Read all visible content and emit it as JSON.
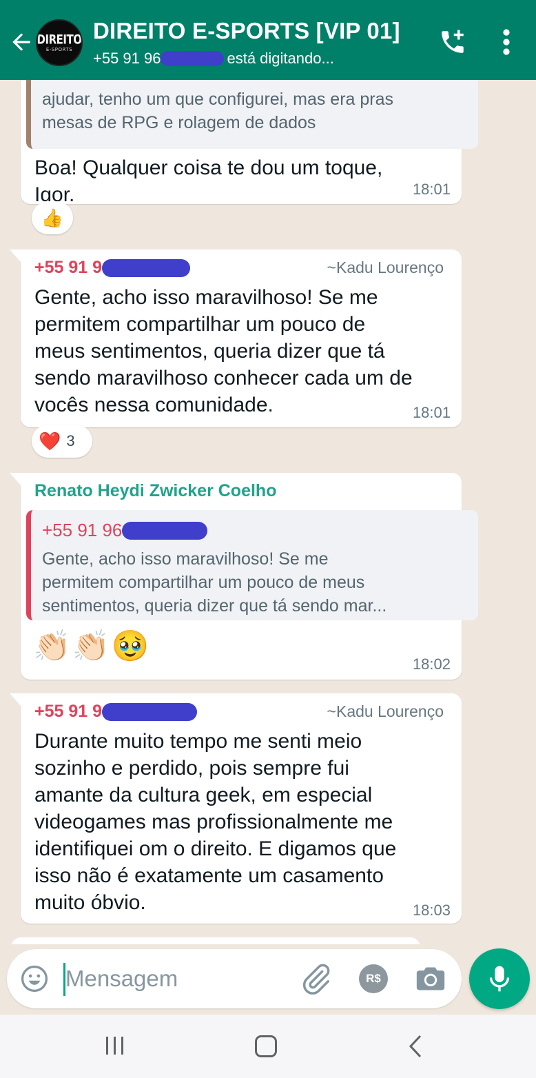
{
  "header": {
    "title": "DIREITO E-SPORTS [VIP 01]",
    "subtitle_prefix": "+55 91 96",
    "subtitle_status": "está digitando...",
    "avatar_text": "DIREITO",
    "avatar_subtext": "E-SPORTS",
    "colors": {
      "bar": "#008069"
    }
  },
  "messages": [
    {
      "quoted_text_lines": [
        "ajudar, tenho um que configurei, mas era pras",
        "mesas de RPG e rolagem de dados"
      ],
      "text_lines": [
        "Boa! Qualquer coisa te dou um toque,",
        "Igor."
      ],
      "time": "18:01",
      "reaction": {
        "emoji": "👍",
        "count": ""
      }
    },
    {
      "sender_prefix": "+55 91 9",
      "alias": "~Kadu Lourenço",
      "text_lines": [
        "Gente, acho isso maravilhoso! Se me",
        "permitem compartilhar um pouco de",
        "meus sentimentos, queria dizer que tá",
        "sendo maravilhoso conhecer cada um de",
        "vocês nessa comunidade."
      ],
      "time": "18:01",
      "reaction": {
        "emoji": "❤️",
        "count": "3"
      }
    },
    {
      "sender": "Renato Heydi Zwicker Coelho",
      "quoted_sender_prefix": "+55 91 96",
      "quoted_text_lines": [
        "Gente, acho isso maravilhoso! Se me",
        "permitem compartilhar um pouco de meus",
        "sentimentos, queria dizer que tá sendo mar..."
      ],
      "emojis": [
        "👏🏻",
        "👏🏻",
        "🥹"
      ],
      "time": "18:02"
    },
    {
      "sender_prefix": "+55 91 9",
      "alias": "~Kadu Lourenço",
      "text_lines": [
        "Durante muito tempo me senti meio",
        "sozinho e perdido, pois sempre fui",
        "amante da cultura geek, em especial",
        "videogames mas profissionalmente me",
        "identifiquei om o direito. E digamos que",
        "isso não é exatamente um casamento",
        "muito óbvio."
      ],
      "time": "18:03"
    }
  ],
  "input": {
    "placeholder": "Mensagem",
    "payment_label": "R$"
  },
  "icons": {
    "back": "arrow-left-icon",
    "call": "add-call-icon",
    "menu": "more-vertical-icon",
    "emoji": "emoji-icon",
    "attach": "paperclip-icon",
    "payment": "payment-icon",
    "camera": "camera-icon",
    "mic": "mic-icon"
  },
  "colors": {
    "accent": "#00a884",
    "sender_red": "#e0425c",
    "sender_teal": "#1fa38a",
    "redaction": "#3f3fcc"
  }
}
